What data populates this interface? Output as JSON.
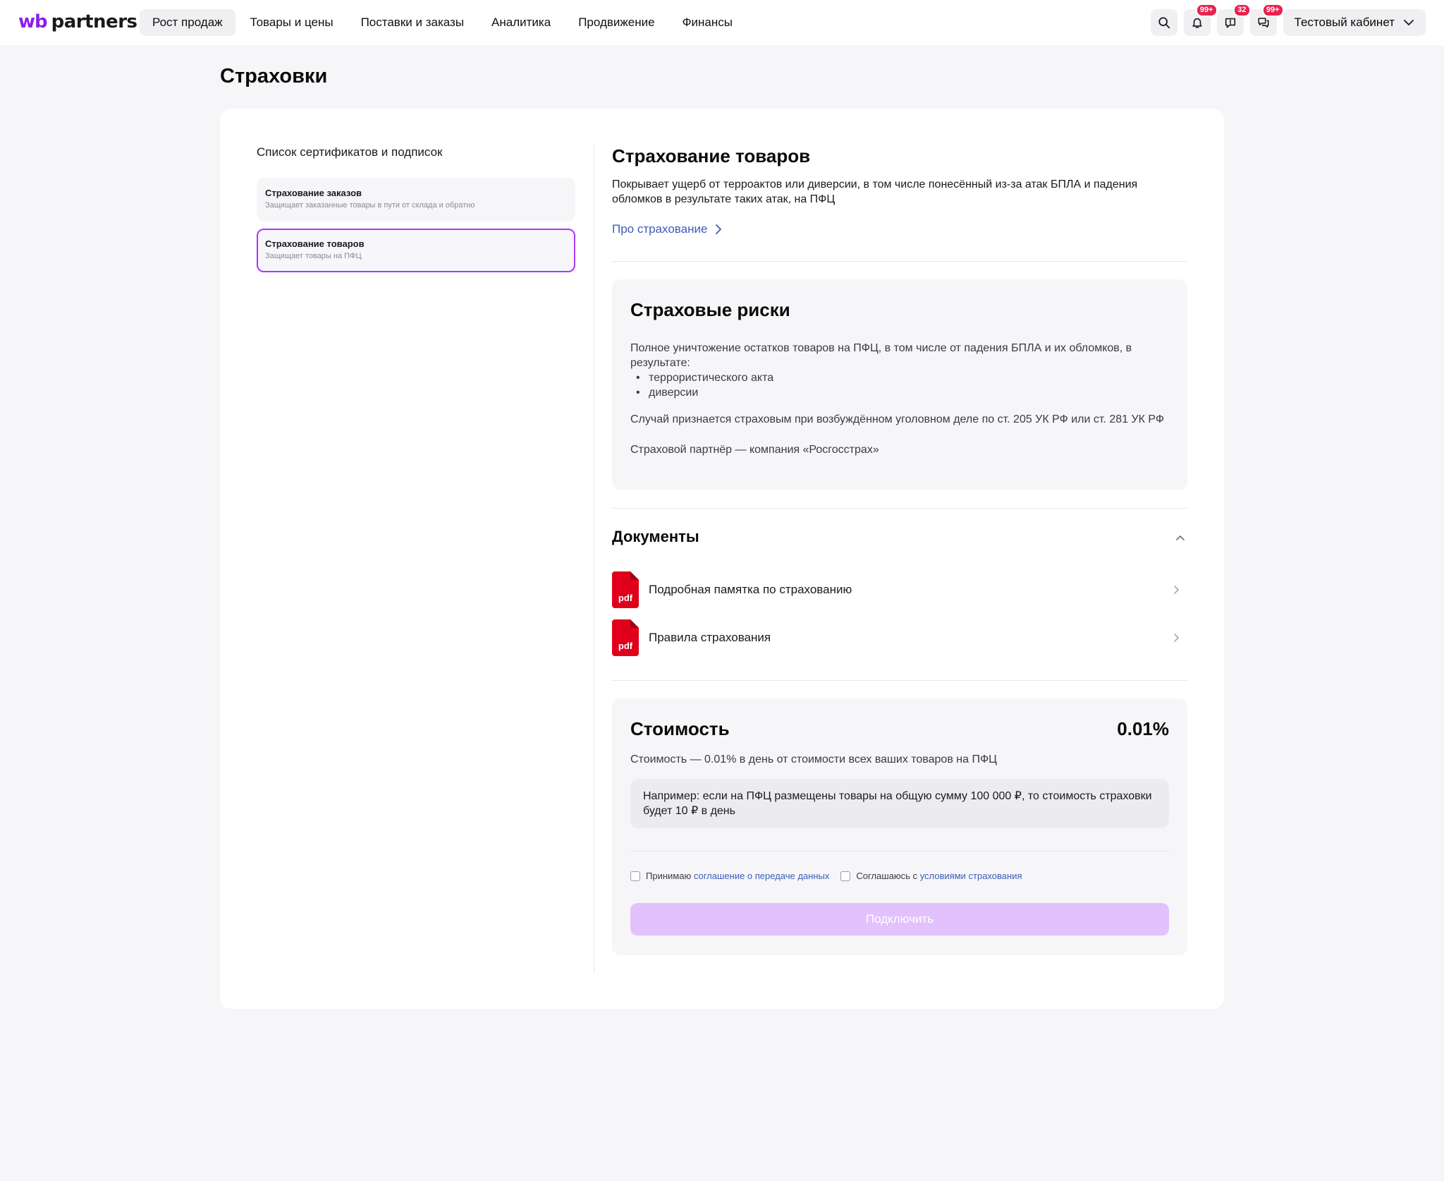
{
  "logo": {
    "wb": "wb",
    "partners": "partners"
  },
  "nav": [
    {
      "label": "Рост продаж"
    },
    {
      "label": "Товары и цены"
    },
    {
      "label": "Поставки и заказы"
    },
    {
      "label": "Аналитика"
    },
    {
      "label": "Продвижение"
    },
    {
      "label": "Финансы"
    }
  ],
  "header": {
    "notifications_badge": "99+",
    "feedback_badge": "32",
    "chat_badge": "99+",
    "cabinet": "Тестовый кабинет"
  },
  "page_title": "Страховки",
  "list": {
    "title": "Список сертификатов и подписок",
    "items": [
      {
        "title": "Страхование заказов",
        "subtitle": "Защищает заказанные товары в пути от склада и обратно"
      },
      {
        "title": "Страхование товаров",
        "subtitle": "Защищает товары на ПФЦ"
      }
    ]
  },
  "detail": {
    "title": "Страхование товаров",
    "description": "Покрывает ущерб от терроактов или диверсии, в том числе понесённый из-за атак БПЛА и падения обломков в результате таких атак, на ПФЦ",
    "about_link": "Про страхование",
    "risks": {
      "title": "Страховые риски",
      "intro": "Полное уничтожение остатков товаров на ПФЦ, в том числе от падения БПЛА и их обломков, в результате:",
      "bullets": [
        "террористического акта",
        "диверсии"
      ],
      "case": "Случай признается страховым при возбуждённом уголовном деле по ст. 205 УК РФ или ст. 281 УК РФ",
      "partner": "Страховой партнёр — компания «Росгосстрах»"
    },
    "documents": {
      "title": "Документы",
      "items": [
        {
          "label": "Подробная памятка по страхованию",
          "icon": "pdf"
        },
        {
          "label": "Правила страхования",
          "icon": "pdf"
        }
      ]
    },
    "cost": {
      "title": "Стоимость",
      "value": "0.01%",
      "description": "Стоимость — 0.01% в день от стоимости всех ваших товаров на ПФЦ",
      "example": "Например: если на ПФЦ размещены товары на общую сумму 100 000 ₽, то стоимость страховки будет 10 ₽ в день",
      "agree1_prefix": "Принимаю",
      "agree1_link": "соглашение о передаче данных",
      "agree2_prefix": "Соглашаюсь с",
      "agree2_link": "условиями страхования",
      "button": "Подключить"
    }
  },
  "colors": {
    "accent": "#a73afd",
    "button_disabled": "#e2c1fd",
    "link": "#3b5db8",
    "badge": "#e5244e",
    "pdf": "#e0001b"
  }
}
